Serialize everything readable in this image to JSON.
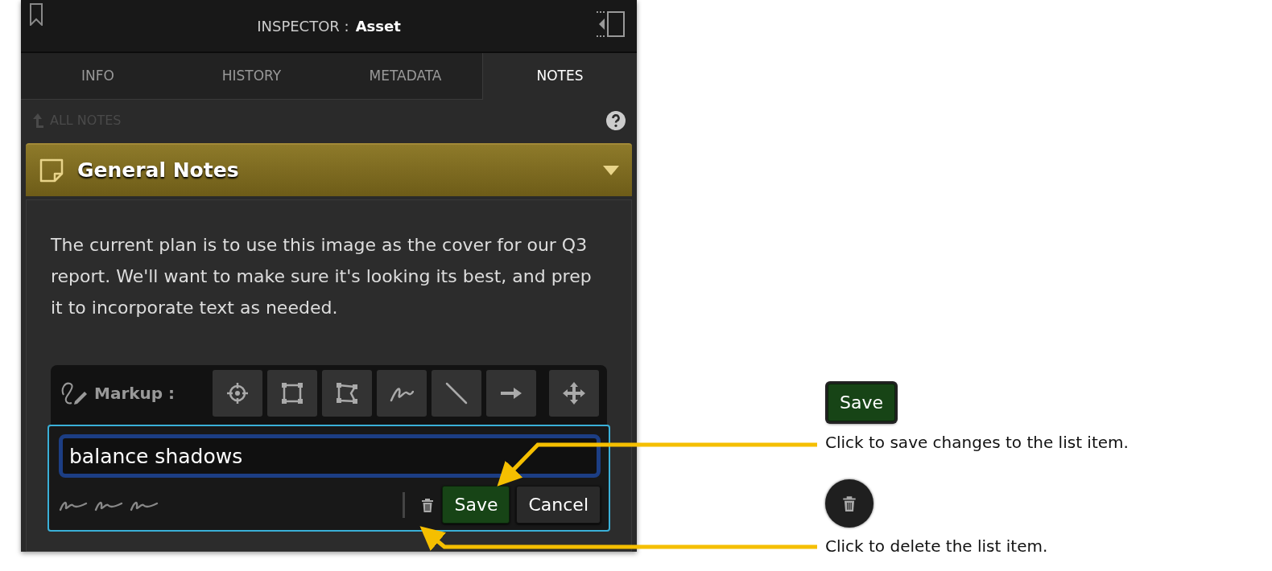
{
  "header": {
    "label": "INSPECTOR :",
    "title": "Asset"
  },
  "tabs": [
    {
      "label": "INFO",
      "selected": false
    },
    {
      "label": "HISTORY",
      "selected": false
    },
    {
      "label": "METADATA",
      "selected": false
    },
    {
      "label": "NOTES",
      "selected": true
    }
  ],
  "back_link": {
    "label": "ALL NOTES",
    "disabled": true
  },
  "section": {
    "title": "General Notes",
    "expanded": true,
    "text": "The current plan is to use this image as the cover for our Q3 report. We'll want to make sure it's looking its best, and prep it to incorporate text as needed."
  },
  "markup": {
    "label": "Markup :"
  },
  "editor": {
    "value": "balance shadows",
    "buttons": [
      {
        "label": "Save",
        "kind": "save"
      },
      {
        "label": "Cancel",
        "kind": "cancel"
      }
    ]
  },
  "callouts": [
    {
      "kind": "save",
      "button_label": "Save",
      "text": "Click to save changes to the list item."
    },
    {
      "kind": "delete",
      "text": "Click to delete the list item."
    }
  ]
}
